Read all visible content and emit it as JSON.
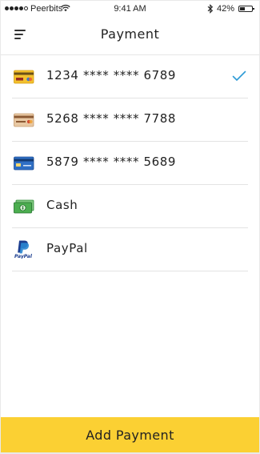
{
  "status_bar": {
    "carrier": "Peerbits",
    "time": "9:41 AM",
    "battery_percent": "42%",
    "battery_level": 0.42,
    "signal_bars_filled": 4,
    "signal_bars_total": 5
  },
  "header": {
    "title": "Payment",
    "menu_icon": "hamburger-menu-icon"
  },
  "payment_methods": [
    {
      "label": "1234 **** **** 6789",
      "icon": "card-yellow-icon",
      "selected": true
    },
    {
      "label": "5268 **** **** 7788",
      "icon": "card-tan-icon",
      "selected": false
    },
    {
      "label": "5879 **** **** 5689",
      "icon": "card-blue-icon",
      "selected": false
    },
    {
      "label": "Cash",
      "icon": "cash-icon",
      "selected": false
    },
    {
      "label": "PayPal",
      "icon": "paypal-icon",
      "selected": false
    }
  ],
  "footer": {
    "add_payment_label": "Add Payment"
  },
  "colors": {
    "accent": "#fbd033",
    "check": "#2e9bd6"
  }
}
